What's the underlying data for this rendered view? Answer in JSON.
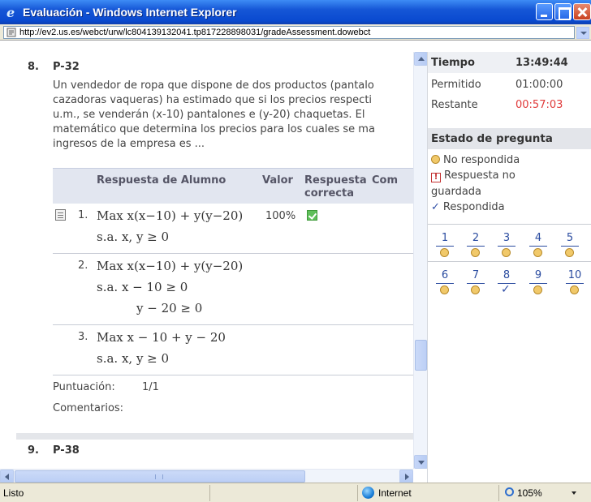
{
  "window": {
    "title": "Evaluación - Windows Internet Explorer",
    "url": "http://ev2.us.es/webct/urw/lc804139132041.tp817228898031/gradeAssessment.dowebct"
  },
  "question": {
    "number": "8.",
    "code": "P-32",
    "text_lines": [
      "Un vendedor de ropa que dispone de dos productos (pantalo",
      "cazadoras vaqueras) ha estimado que si los precios respecti",
      "u.m., se venderán (x-10) pantalones e (y-20) chaquetas. El",
      "matemático que determina los precios para los cuales se ma",
      "ingresos de la empresa es ..."
    ],
    "table_headers": {
      "alumno": "Respuesta de Alumno",
      "valor": "Valor",
      "correcta_line1": "Respuesta",
      "correcta_line2": "correcta",
      "comentarios": "Com"
    },
    "answers": [
      {
        "index": "1.",
        "line1": "Max x(x−10) + y(y−20)",
        "line2": "s.a.   x, y ≥ 0",
        "valor": "100%",
        "correct": true
      },
      {
        "index": "2.",
        "line1": "Max x(x−10) + y(y−20)",
        "line2": "s.a.   x − 10 ≥ 0",
        "line3": "y − 20 ≥ 0"
      },
      {
        "index": "3.",
        "line1": "Max x − 10 + y − 20",
        "line2": "s.a.   x, y ≥ 0"
      }
    ],
    "score_label": "Puntuación:",
    "score_value": "1/1",
    "comments_label": "Comentarios:"
  },
  "next_question": {
    "number": "9.",
    "code": "P-38"
  },
  "timer": {
    "label": "Tiempo",
    "clock": "13:49:44",
    "allowed_label": "Permitido",
    "allowed_value": "01:00:00",
    "remaining_label": "Restante",
    "remaining_value": "00:57:03",
    "remaining_color": "#e03a3a"
  },
  "status_panel": {
    "title": "Estado de pregunta",
    "legend_unanswered": "No respondida",
    "legend_unsaved_line1": "Respuesta no",
    "legend_unsaved_line2": "guardada",
    "legend_answered": "Respondida",
    "questions_row1": [
      "1",
      "2",
      "3",
      "4",
      "5"
    ],
    "questions_row2": [
      "6",
      "7",
      "8",
      "9",
      "10"
    ],
    "answered_question": "8"
  },
  "statusbar": {
    "text": "Listo",
    "zone": "Internet",
    "zoom": "105%"
  },
  "icons": {
    "browser": "ie-icon",
    "security": "lock-icon",
    "zone": "globe-icon",
    "zoom": "zoom-icon"
  }
}
